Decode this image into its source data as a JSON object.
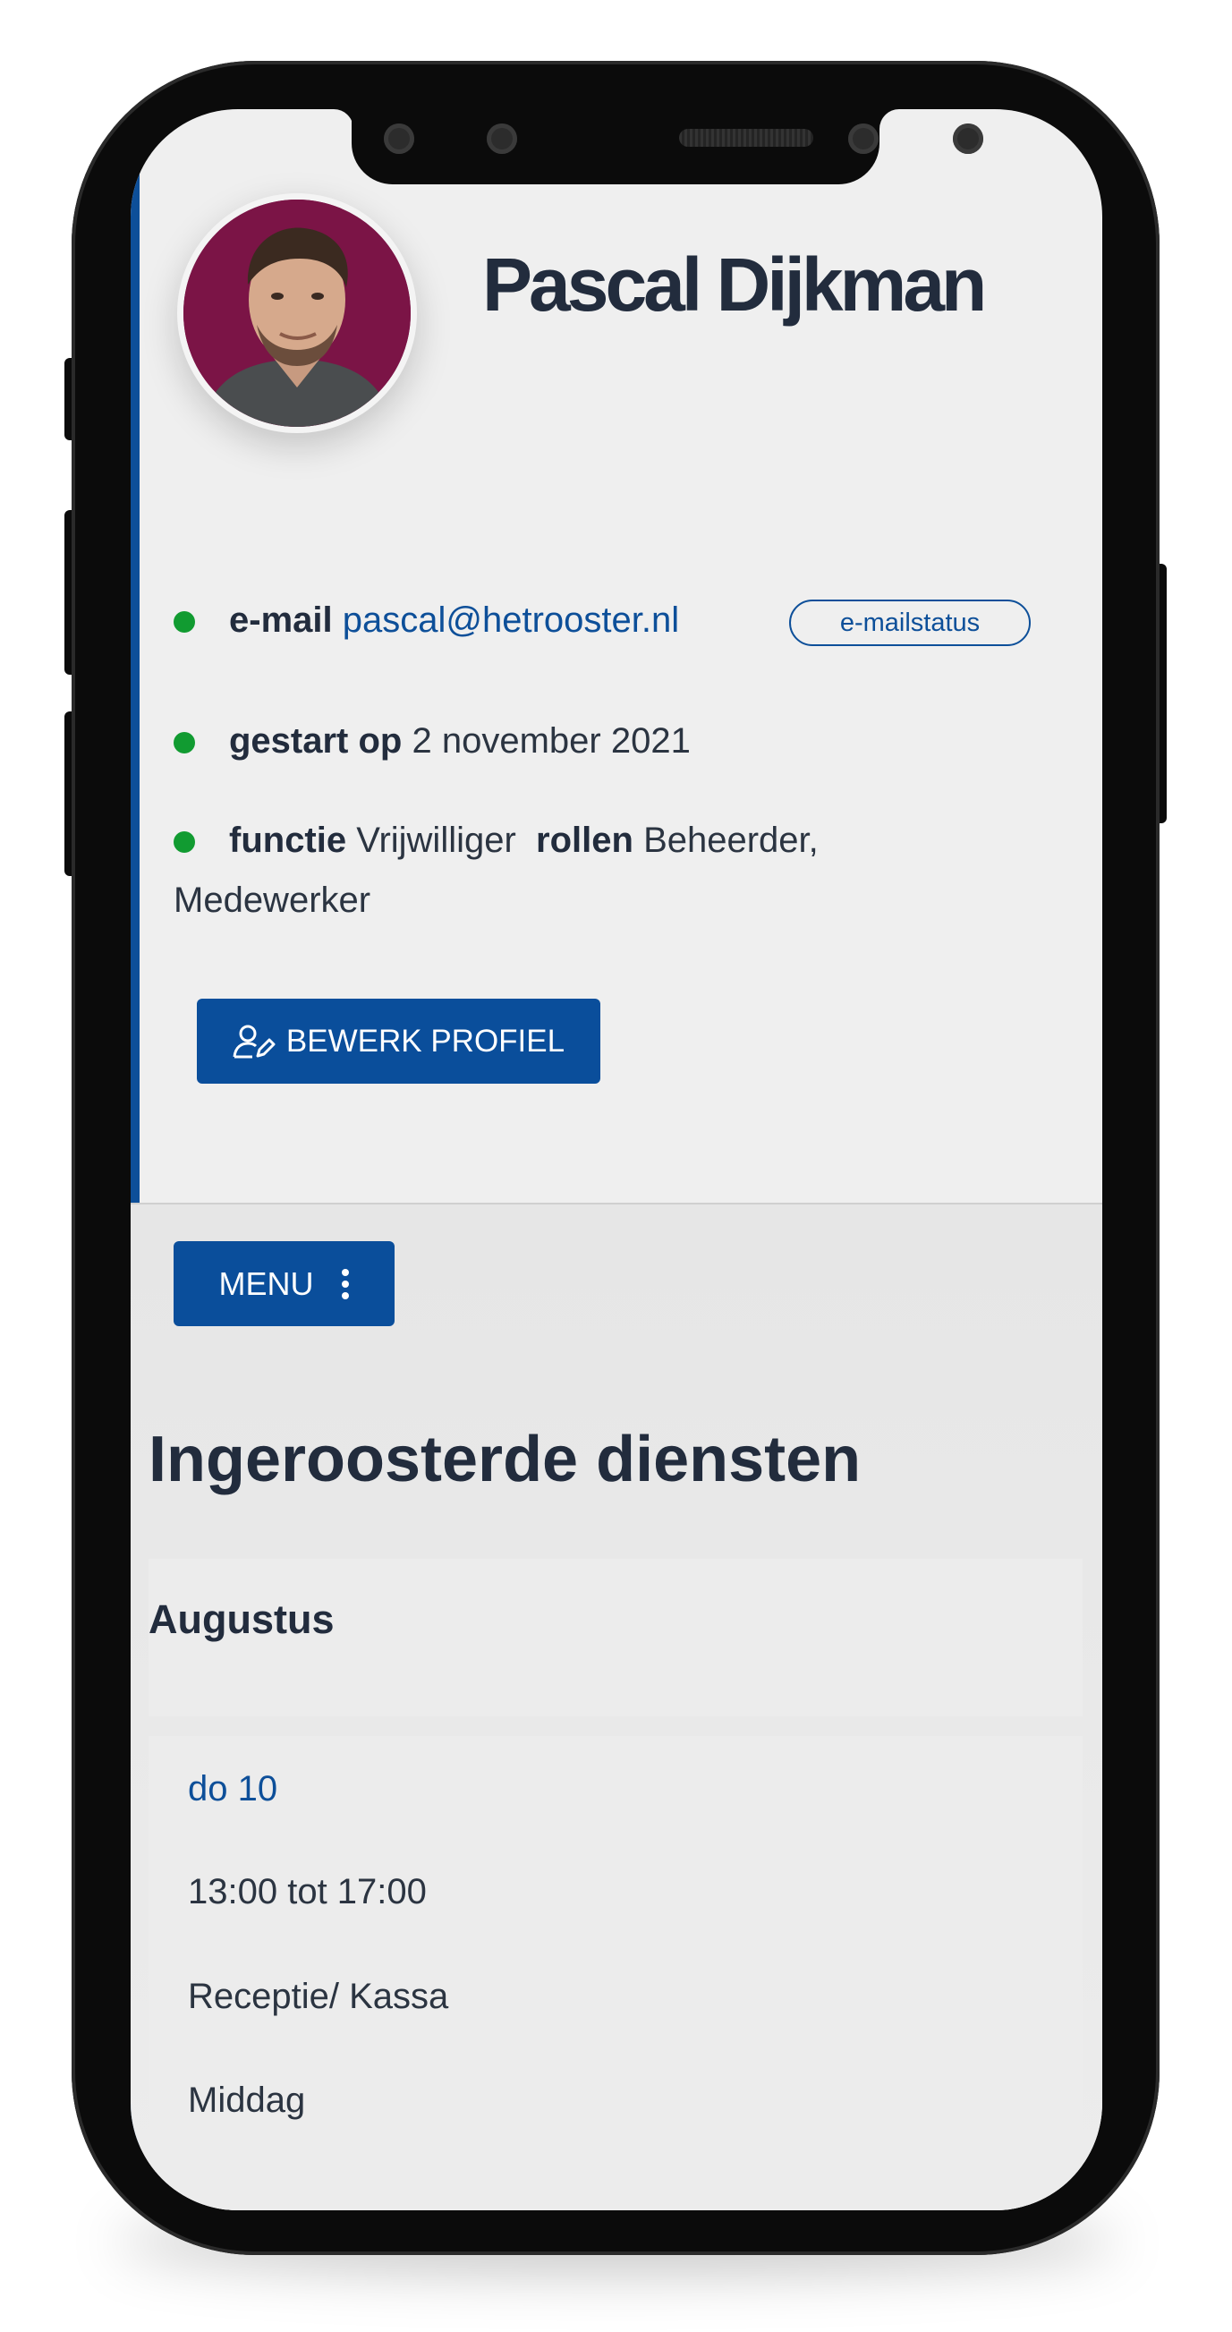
{
  "profile": {
    "name": "Pascal Dijkman",
    "email_label": "e-mail",
    "email": "pascal@hetrooster.nl",
    "email_status_label": "e-mailstatus",
    "started_label": "gestart op",
    "started_value": "2 november 2021",
    "function_label": "functie",
    "function_value": "Vrijwilliger",
    "roles_label": "rollen",
    "roles_value_line1": "Beheerder,",
    "roles_value_line2": "Medewerker",
    "edit_button_label": "BEWERK PROFIEL"
  },
  "menu": {
    "label": "MENU"
  },
  "schedule": {
    "title": "Ingeroosterde diensten",
    "month": "Augustus",
    "shift": {
      "day": "do 10",
      "time": "13:00 tot 17:00",
      "role": "Receptie/ Kassa",
      "part": "Middag"
    }
  },
  "colors": {
    "accent": "#0d4f99",
    "status_dot": "#119b31",
    "avatar_bg": "#7b1446",
    "text": "#222c3d"
  },
  "icons": {
    "edit": "user-edit-icon",
    "menu": "vertical-dots-icon",
    "status": "status-dot-icon"
  }
}
